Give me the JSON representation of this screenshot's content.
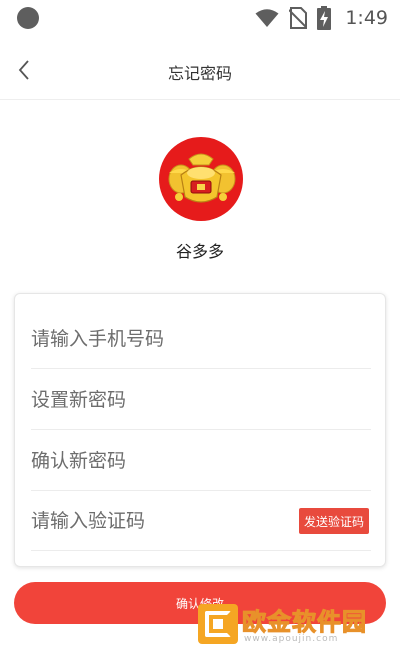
{
  "status_bar": {
    "time": "1:49",
    "icons": [
      "circle-indicator",
      "wifi-icon",
      "no-sim-icon",
      "battery-charging-icon"
    ]
  },
  "header": {
    "title": "忘记密码",
    "back_icon": "chevron-left-icon"
  },
  "app": {
    "name": "谷多多",
    "logo": "gold-ingot-logo",
    "logo_bg": "#e61b1b"
  },
  "form": {
    "phone_placeholder": "请输入手机号码",
    "new_password_placeholder": "设置新密码",
    "confirm_password_placeholder": "确认新密码",
    "code_placeholder": "请输入验证码",
    "send_code_label": "发送验证码"
  },
  "submit": {
    "label": "确认修改"
  },
  "watermark": {
    "title": "欧金软件园",
    "url": "www.apoujin.com"
  },
  "colors": {
    "accent": "#f1443a",
    "send_button": "#e84a3d",
    "watermark": "#f5a623"
  }
}
